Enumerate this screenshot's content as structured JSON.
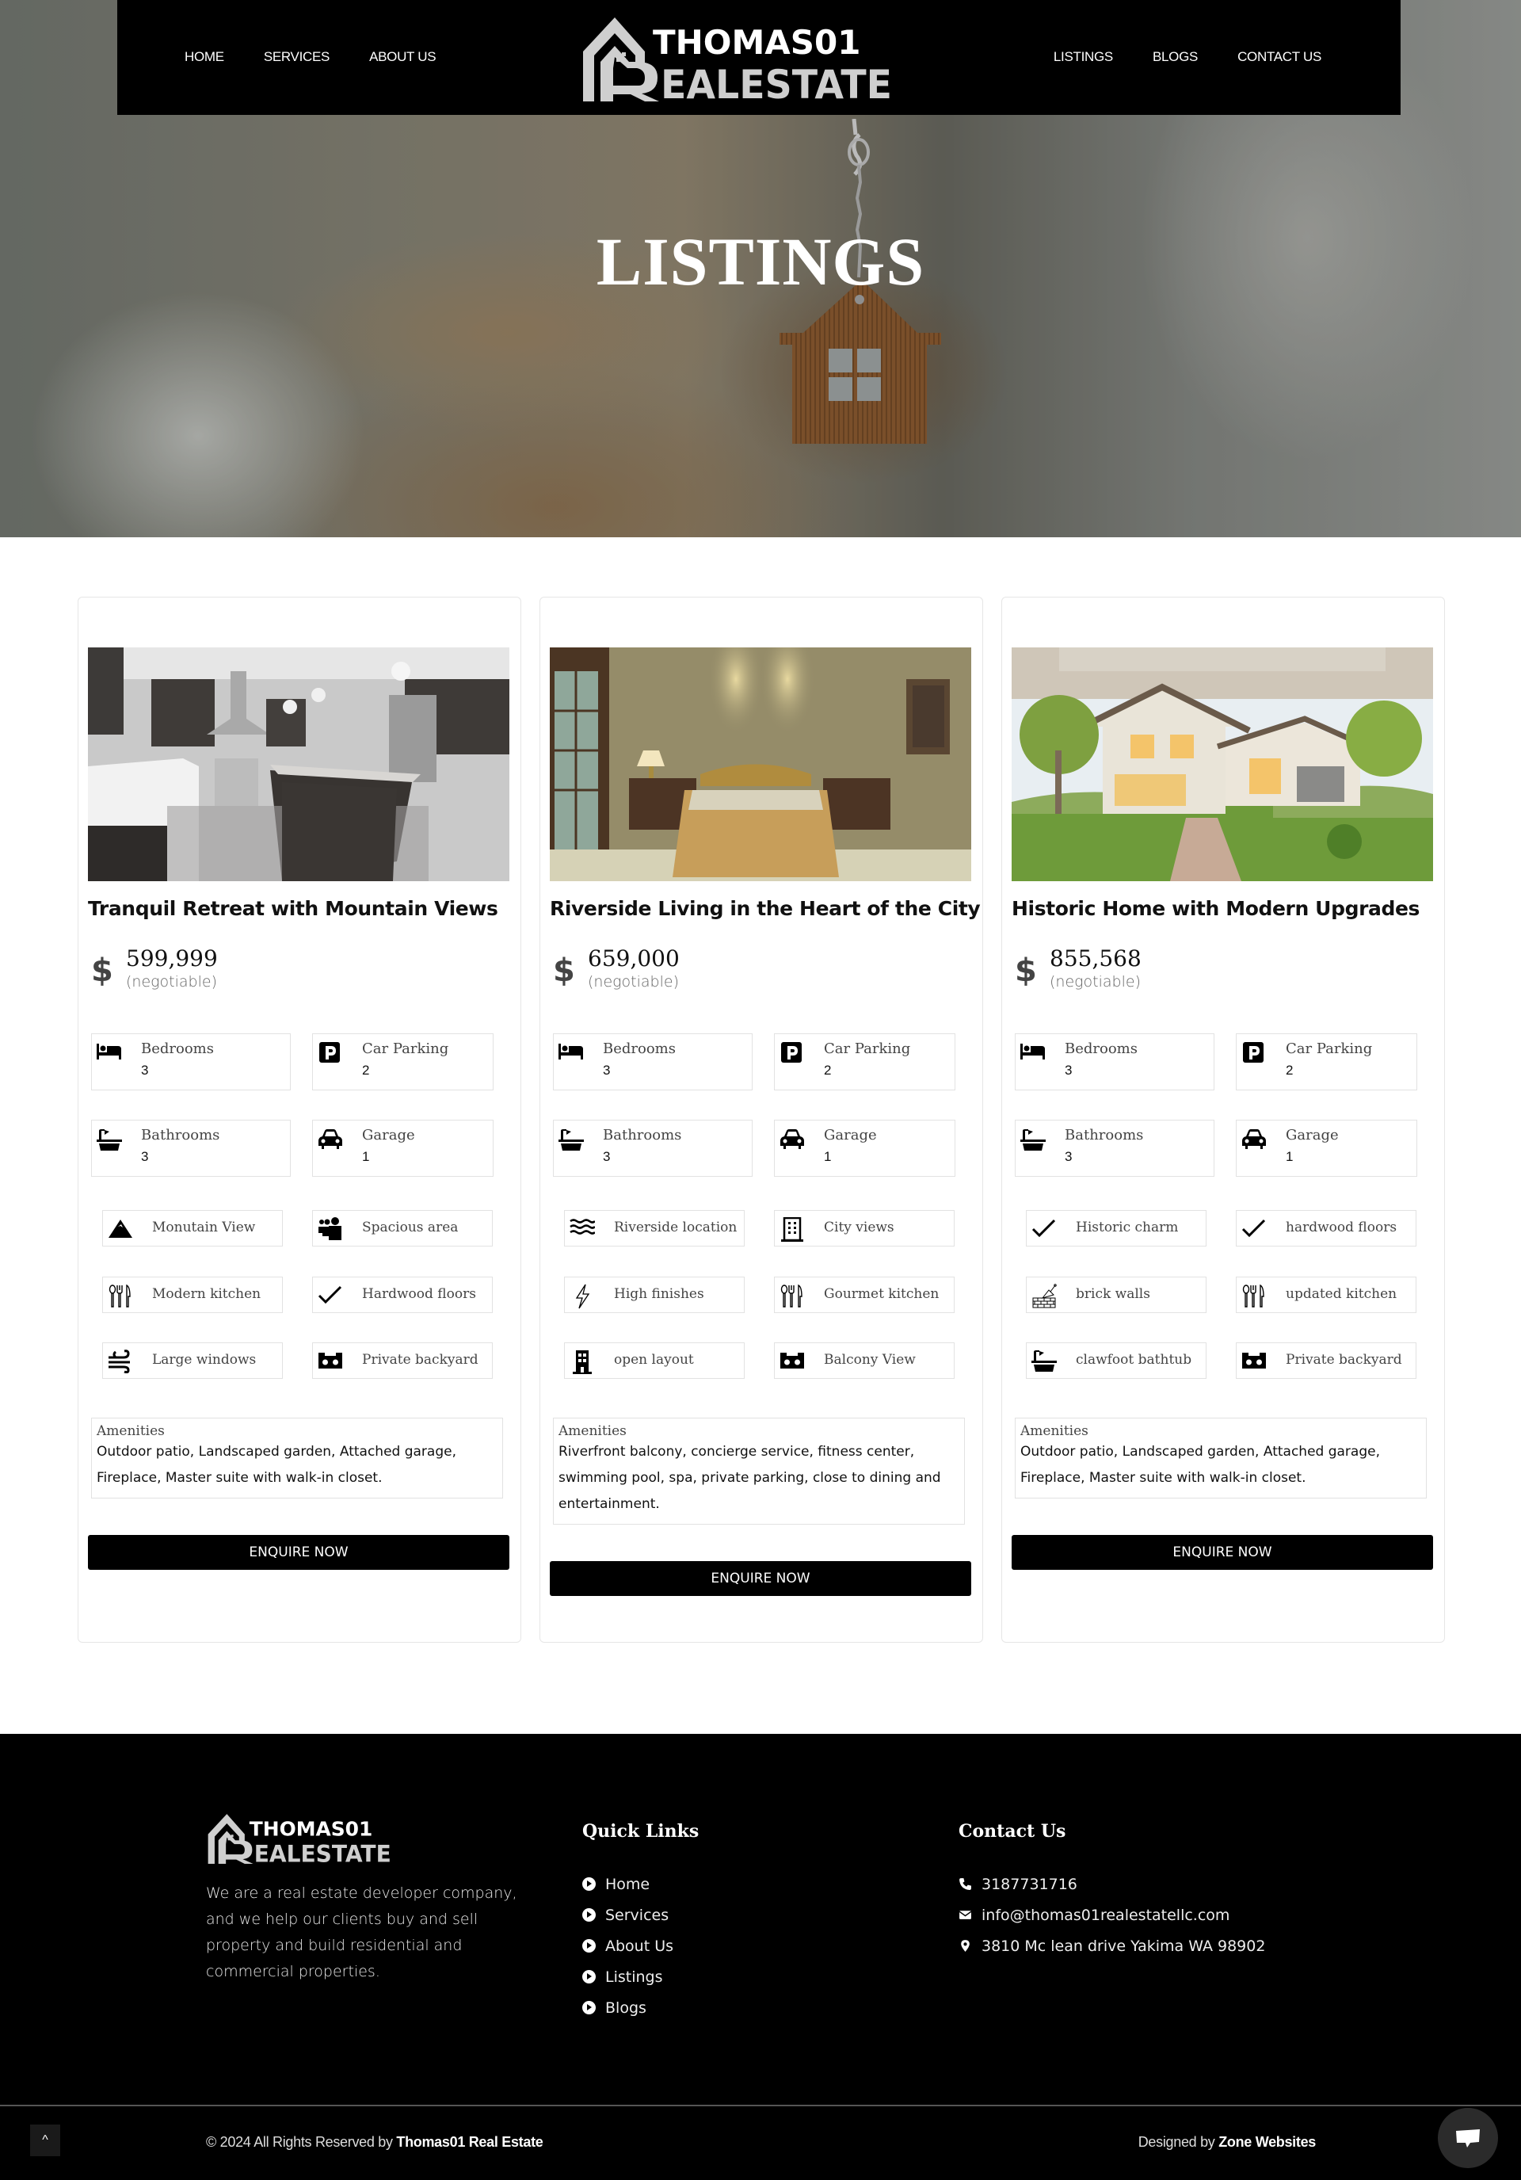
{
  "nav": {
    "left": [
      "HOME",
      "SERVICES",
      "ABOUT US"
    ],
    "right": [
      "LISTINGS",
      "BLOGS",
      "CONTACT US"
    ],
    "logo_line1": "THOMAS01",
    "logo_line2": "EALESTATE"
  },
  "hero": {
    "title": "LISTINGS"
  },
  "listings": [
    {
      "title": "Tranquil Retreat with Mountain Views",
      "photo": "kitchen",
      "price": "599,999",
      "price_note": "(negotiable)",
      "stats": [
        {
          "icon": "bed-icon",
          "label": "Bedrooms",
          "value": "3"
        },
        {
          "icon": "parking-icon",
          "label": "Car Parking",
          "value": "2"
        },
        {
          "icon": "bath-icon",
          "label": "Bathrooms",
          "value": "3"
        },
        {
          "icon": "car-icon",
          "label": "Garage",
          "value": "1"
        }
      ],
      "features": [
        {
          "icon": "mountain-icon",
          "label": "Monutain View"
        },
        {
          "icon": "people-icon",
          "label": "Spacious area"
        },
        {
          "icon": "utensils-icon",
          "label": "Modern kitchen"
        },
        {
          "icon": "check-icon",
          "label": "Hardwood floors"
        },
        {
          "icon": "wind-icon",
          "label": "Large windows"
        },
        {
          "icon": "vr-icon",
          "label": "Private backyard"
        }
      ],
      "amenities_title": "Amenities",
      "amenities": "Outdoor patio, Landscaped garden, Attached garage, Fireplace, Master suite with walk-in closet.",
      "button": "ENQUIRE NOW"
    },
    {
      "title": "Riverside Living in the Heart of the City",
      "photo": "bedroom",
      "price": "659,000",
      "price_note": "(negotiable)",
      "stats": [
        {
          "icon": "bed-icon",
          "label": "Bedrooms",
          "value": "3"
        },
        {
          "icon": "parking-icon",
          "label": "Car Parking",
          "value": "2"
        },
        {
          "icon": "bath-icon",
          "label": "Bathrooms",
          "value": "3"
        },
        {
          "icon": "car-icon",
          "label": "Garage",
          "value": "1"
        }
      ],
      "features": [
        {
          "icon": "water-icon",
          "label": "Riverside location"
        },
        {
          "icon": "building-outline-icon",
          "label": "City views"
        },
        {
          "icon": "bolt-icon",
          "label": "High finishes"
        },
        {
          "icon": "utensils-icon",
          "label": "Gourmet kitchen"
        },
        {
          "icon": "building-icon",
          "label": "open layout"
        },
        {
          "icon": "vr-icon",
          "label": "Balcony View"
        }
      ],
      "amenities_title": "Amenities",
      "amenities": "Riverfront balcony, concierge service, fitness center, swimming pool, spa, private parking, close to dining and entertainment.",
      "button": "ENQUIRE NOW"
    },
    {
      "title": "Historic Home with Modern Upgrades",
      "photo": "house",
      "price": "855,568",
      "price_note": "(negotiable)",
      "stats": [
        {
          "icon": "bed-icon",
          "label": "Bedrooms",
          "value": "3"
        },
        {
          "icon": "parking-icon",
          "label": "Car Parking",
          "value": "2"
        },
        {
          "icon": "bath-icon",
          "label": "Bathrooms",
          "value": "3"
        },
        {
          "icon": "car-icon",
          "label": "Garage",
          "value": "1"
        }
      ],
      "features": [
        {
          "icon": "check-icon",
          "label": "Historic charm"
        },
        {
          "icon": "check-icon",
          "label": "hardwood floors"
        },
        {
          "icon": "brick-icon",
          "label": "brick walls"
        },
        {
          "icon": "utensils-icon",
          "label": "updated kitchen"
        },
        {
          "icon": "bath-icon",
          "label": "clawfoot bathtub"
        },
        {
          "icon": "vr-icon",
          "label": "Private backyard"
        }
      ],
      "amenities_title": "Amenities",
      "amenities": "Outdoor patio, Landscaped garden, Attached garage, Fireplace, Master suite with walk-in closet.",
      "button": "ENQUIRE NOW"
    }
  ],
  "footer": {
    "about": "We are a real estate developer company, and we help our clients buy and sell property and build residential and commercial properties.",
    "quick_links_title": "Quick Links",
    "quick_links": [
      "Home",
      "Services",
      "About Us",
      "Listings",
      "Blogs"
    ],
    "contact_title": "Contact Us",
    "contact": [
      {
        "icon": "phone-icon",
        "text": "3187731716"
      },
      {
        "icon": "envelope-icon",
        "text": "info@thomas01realestatellc.com"
      },
      {
        "icon": "map-pin-icon",
        "text": "3810 Mc lean drive Yakima WA 98902"
      }
    ],
    "copyright_prefix": "© 2024 All Rights Reserved by ",
    "copyright_brand": "Thomas01 Real Estate",
    "designed_prefix": "Designed by ",
    "designed_brand": "Zone Websites",
    "to_top_icon": "chevron-up-icon",
    "chat_icon": "chat-icon"
  }
}
